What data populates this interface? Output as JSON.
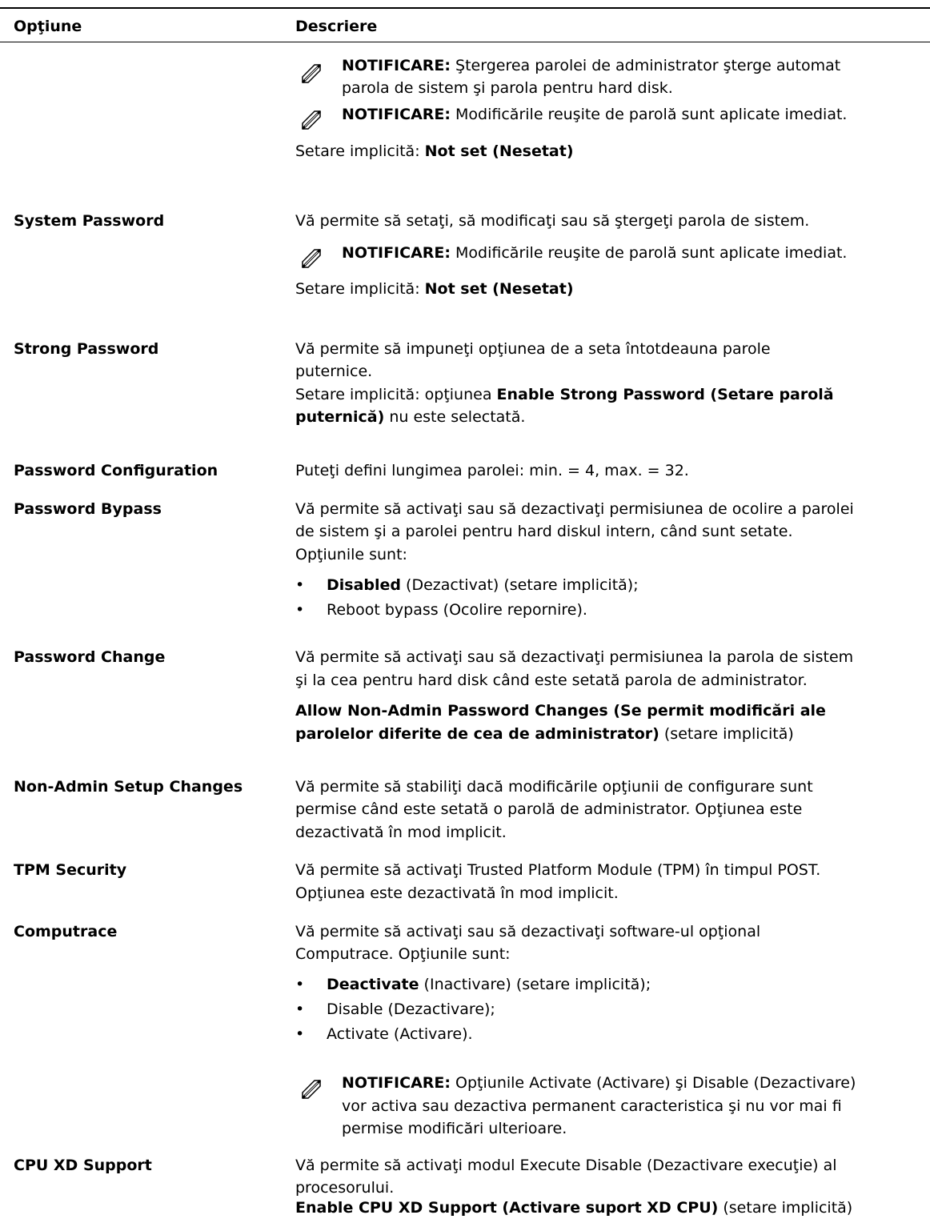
{
  "header": {
    "option": "Opţiune",
    "description": "Descriere"
  },
  "note_label": "NOTIFICARE:",
  "default_label": "Setare implicită:",
  "bullet": "•",
  "rows": {
    "admin": {
      "note1_l1": " Ştergerea parolei de administrator şterge automat",
      "note1_l2": "parola de sistem şi parola pentru hard disk.",
      "note2": " Modificările reuşite de parolă sunt aplicate imediat.",
      "default_value": "Not set (Nesetat)"
    },
    "system_password": {
      "name": "System Password",
      "desc": "Vă permite să setaţi, să modificaţi sau să ştergeţi parola de sistem.",
      "note": " Modificările reuşite de parolă sunt aplicate imediat.",
      "default_value": "Not set (Nesetat)"
    },
    "strong_password": {
      "name": "Strong Password",
      "desc_l1": "Vă permite să impuneţi opţiunea de a seta întotdeauna parole",
      "desc_l2": "puternice.",
      "default_prefix": "Setare implicită: opţiunea ",
      "default_bold_l1": "Enable Strong Password (Setare parolă",
      "default_bold_l2": "puternică)",
      "default_suffix": " nu este selectată."
    },
    "password_configuration": {
      "name": "Password Configuration",
      "desc": "Puteţi defini lungimea parolei: min. = 4, max. = 32."
    },
    "password_bypass": {
      "name": "Password Bypass",
      "desc_l1": "Vă permite să activaţi sau să dezactivaţi permisiunea de ocolire a parolei",
      "desc_l2": "de sistem şi a parolei pentru hard diskul intern, când sunt setate.",
      "desc_l3": "Opţiunile sunt:",
      "item1_bold": "Disabled",
      "item1_rest": " (Dezactivat) (setare implicită);",
      "item2": "Reboot bypass (Ocolire repornire)."
    },
    "password_change": {
      "name": "Password Change",
      "desc_l1": "Vă permite să activaţi sau să dezactivaţi permisiunea la parola de sistem",
      "desc_l2": "şi la cea pentru hard disk când este setată parola de administrator.",
      "default_bold_l1": "Allow Non-Admin Password Changes (Se permit modificări ale",
      "default_bold_l2": "parolelor diferite de cea de administrator)",
      "default_suffix": " (setare implicită)"
    },
    "non_admin_setup": {
      "name": "Non-Admin Setup Changes",
      "desc_l1": "Vă permite să stabiliţi dacă modificările opţiunii de configurare sunt",
      "desc_l2": "permise când este setată o parolă de administrator. Opţiunea este",
      "desc_l3": "dezactivată în mod implicit."
    },
    "tpm_security": {
      "name": "TPM Security",
      "desc_l1": "Vă permite să activaţi Trusted Platform Module (TPM) în timpul POST.",
      "desc_l2": "Opţiunea este dezactivată în mod implicit."
    },
    "computrace": {
      "name": "Computrace",
      "desc_l1": "Vă permite să activaţi sau să dezactivaţi software-ul opţional",
      "desc_l2": "Computrace. Opţiunile sunt:",
      "item1_bold": "Deactivate",
      "item1_rest": " (Inactivare) (setare implicită);",
      "item2": "Disable (Dezactivare);",
      "item3": "Activate (Activare).",
      "note_l1": " Opţiunile Activate (Activare) şi Disable (Dezactivare)",
      "note_l2": "vor activa sau dezactiva permanent caracteristica şi nu vor mai fi",
      "note_l3": "permise modificări ulterioare."
    },
    "cpu_xd": {
      "name": "CPU XD Support",
      "desc_l1": "Vă permite să activaţi modul Execute Disable (Dezactivare execuţie) al",
      "desc_l2": "procesorului.",
      "default_bold": "Enable CPU XD Support (Activare suport XD CPU)",
      "default_suffix": " (setare implicită)"
    }
  }
}
